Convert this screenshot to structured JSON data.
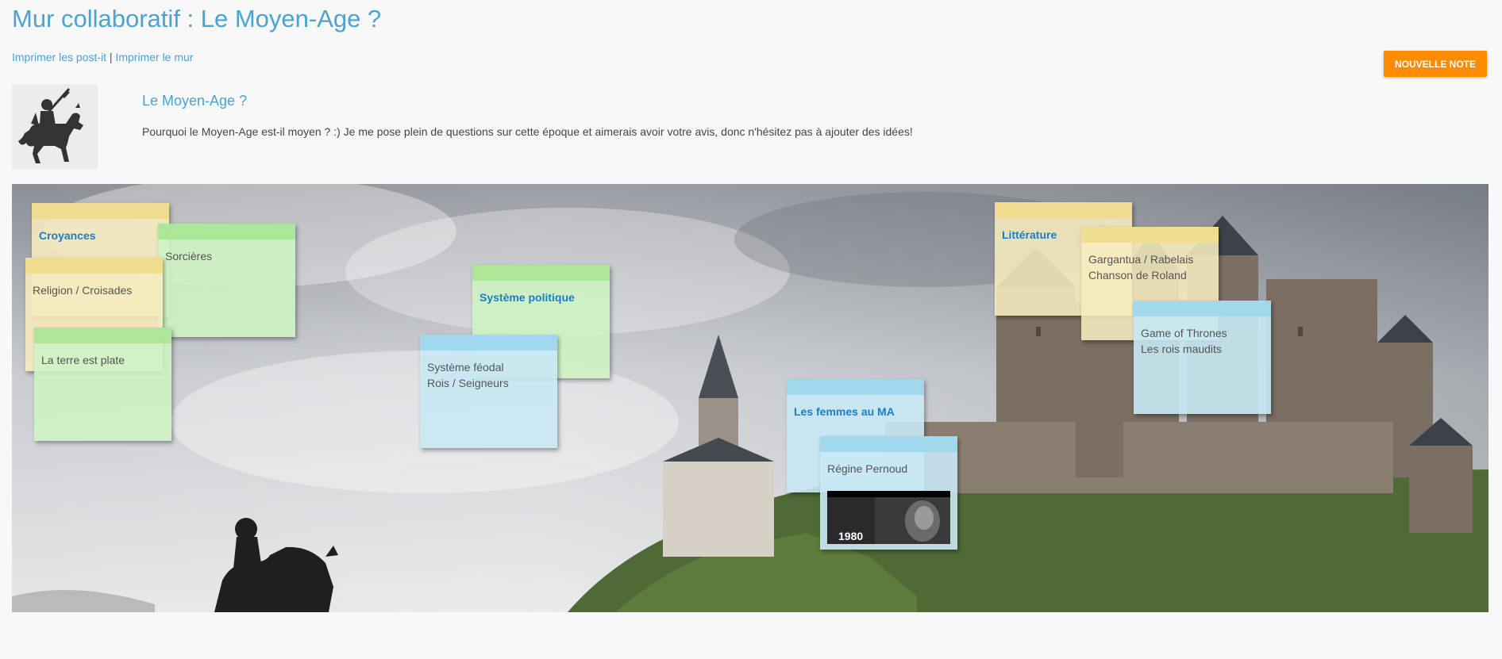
{
  "header": {
    "title": "Mur collaboratif : Le Moyen-Age ?",
    "print_postits": "Imprimer les post-it",
    "separator": " | ",
    "print_wall": "Imprimer le mur",
    "new_note_button": "NOUVELLE NOTE"
  },
  "wall_info": {
    "name": "Le Moyen-Age ?",
    "description": "Pourquoi le Moyen-Age est-il moyen ? :) Je me pose plein de questions sur cette époque et aimerais avoir votre avis, donc n'hésitez pas à ajouter des idées!",
    "thumbnail_icon": "knight-on-horse-icon"
  },
  "notes": {
    "croyances": {
      "lines": [
        "Croyances"
      ],
      "color": "yellow",
      "is_title": true
    },
    "sorcieres": {
      "lines": [
        "Sorcières"
      ],
      "color": "green",
      "is_title": false
    },
    "religion": {
      "lines": [
        "Religion / Croisades"
      ],
      "color": "yellow",
      "is_title": false
    },
    "terre_plate": {
      "lines": [
        "La terre est plate"
      ],
      "color": "green",
      "is_title": false
    },
    "systeme_politique": {
      "lines": [
        "Système politique"
      ],
      "color": "green",
      "is_title": true
    },
    "systeme_feodal": {
      "lines": [
        "Système féodal",
        "Rois / Seigneurs"
      ],
      "color": "blue",
      "is_title": false
    },
    "femmes_ma": {
      "lines": [
        "Les femmes au MA"
      ],
      "color": "blue",
      "is_title": true
    },
    "regine_pernoud": {
      "lines": [
        "Régine Pernoud"
      ],
      "color": "blue",
      "is_title": false,
      "video_caption": "1980"
    },
    "litterature": {
      "lines": [
        "Littérature"
      ],
      "color": "yellow",
      "is_title": true
    },
    "gargantua": {
      "lines": [
        "Gargantua / Rabelais",
        "Chanson de Roland"
      ],
      "color": "yellow",
      "is_title": false
    },
    "game_of_thrones": {
      "lines": [
        "Game of Thrones",
        "Les rois maudits"
      ],
      "color": "blue",
      "is_title": false
    }
  },
  "colors": {
    "accent": "#4aa3d1",
    "button": "#ff8c00",
    "note_title": "#1a7fc4"
  }
}
